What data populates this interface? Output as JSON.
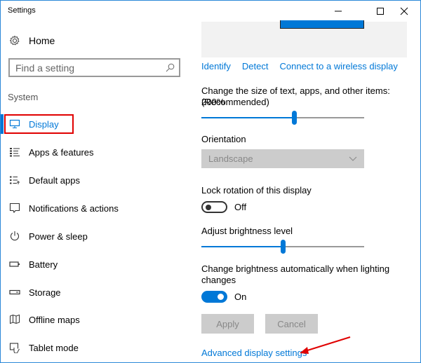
{
  "window": {
    "title": "Settings",
    "controls": {
      "minimize": "minimize",
      "maximize": "maximize",
      "close": "close"
    }
  },
  "sidebar": {
    "home_label": "Home",
    "search": {
      "placeholder": "Find a setting",
      "value": ""
    },
    "section_label": "System",
    "items": [
      {
        "label": "Display",
        "icon": "monitor-icon",
        "active": true
      },
      {
        "label": "Apps & features",
        "icon": "list-icon"
      },
      {
        "label": "Default apps",
        "icon": "default-apps-icon"
      },
      {
        "label": "Notifications & actions",
        "icon": "notification-icon"
      },
      {
        "label": "Power & sleep",
        "icon": "power-icon"
      },
      {
        "label": "Battery",
        "icon": "battery-icon"
      },
      {
        "label": "Storage",
        "icon": "storage-icon"
      },
      {
        "label": "Offline maps",
        "icon": "map-icon"
      },
      {
        "label": "Tablet mode",
        "icon": "tablet-icon"
      }
    ]
  },
  "main": {
    "links": {
      "identify": "Identify",
      "detect": "Detect",
      "wireless": "Connect to a wireless display"
    },
    "scale": {
      "label_line1": "Change the size of text, apps, and other items: 200%",
      "label_line2": "(Recommended)",
      "value_fraction": 0.57
    },
    "orientation": {
      "label": "Orientation",
      "value": "Landscape"
    },
    "lock_rotation": {
      "label": "Lock rotation of this display",
      "state": "Off"
    },
    "brightness": {
      "label": "Adjust brightness level",
      "value_fraction": 0.5
    },
    "auto_brightness": {
      "label_line1": "Change brightness automatically when lighting",
      "label_line2": "changes",
      "state": "On"
    },
    "apply_label": "Apply",
    "cancel_label": "Cancel",
    "advanced_link": "Advanced display settings"
  },
  "colors": {
    "accent": "#0078d7",
    "highlight": "#e00000"
  }
}
